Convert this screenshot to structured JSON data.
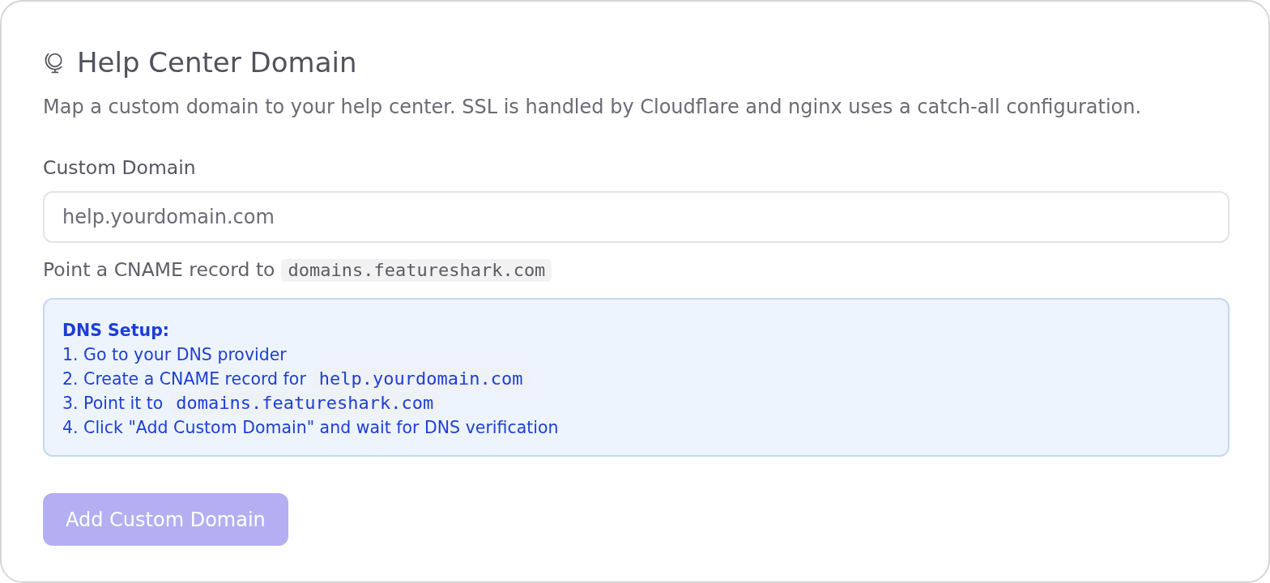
{
  "section": {
    "title": "Help Center Domain",
    "description": "Map a custom domain to your help center. SSL is handled by Cloudflare and nginx uses a catch-all configuration."
  },
  "domain_field": {
    "label": "Custom Domain",
    "placeholder": "help.yourdomain.com"
  },
  "hint": [
    {
      "kind": "text",
      "text": "Point a CNAME record to"
    },
    {
      "kind": "code",
      "text": "domains.featureshark.com"
    }
  ],
  "dns_setup": {
    "title": "DNS Setup:",
    "steps": [
      {
        "parts": [
          {
            "kind": "text",
            "text": "1. Go to your DNS provider"
          }
        ]
      },
      {
        "parts": [
          {
            "kind": "text",
            "text": "2. Create a CNAME record for"
          },
          {
            "kind": "code",
            "text": "help.yourdomain.com"
          }
        ]
      },
      {
        "parts": [
          {
            "kind": "text",
            "text": "3. Point it to"
          },
          {
            "kind": "code",
            "text": "domains.featureshark.com"
          }
        ]
      },
      {
        "parts": [
          {
            "kind": "text",
            "text": "4. Click \"Add Custom Domain\" and wait for DNS verification"
          }
        ]
      }
    ]
  },
  "button": {
    "label": "Add Custom Domain",
    "disabled": true
  }
}
